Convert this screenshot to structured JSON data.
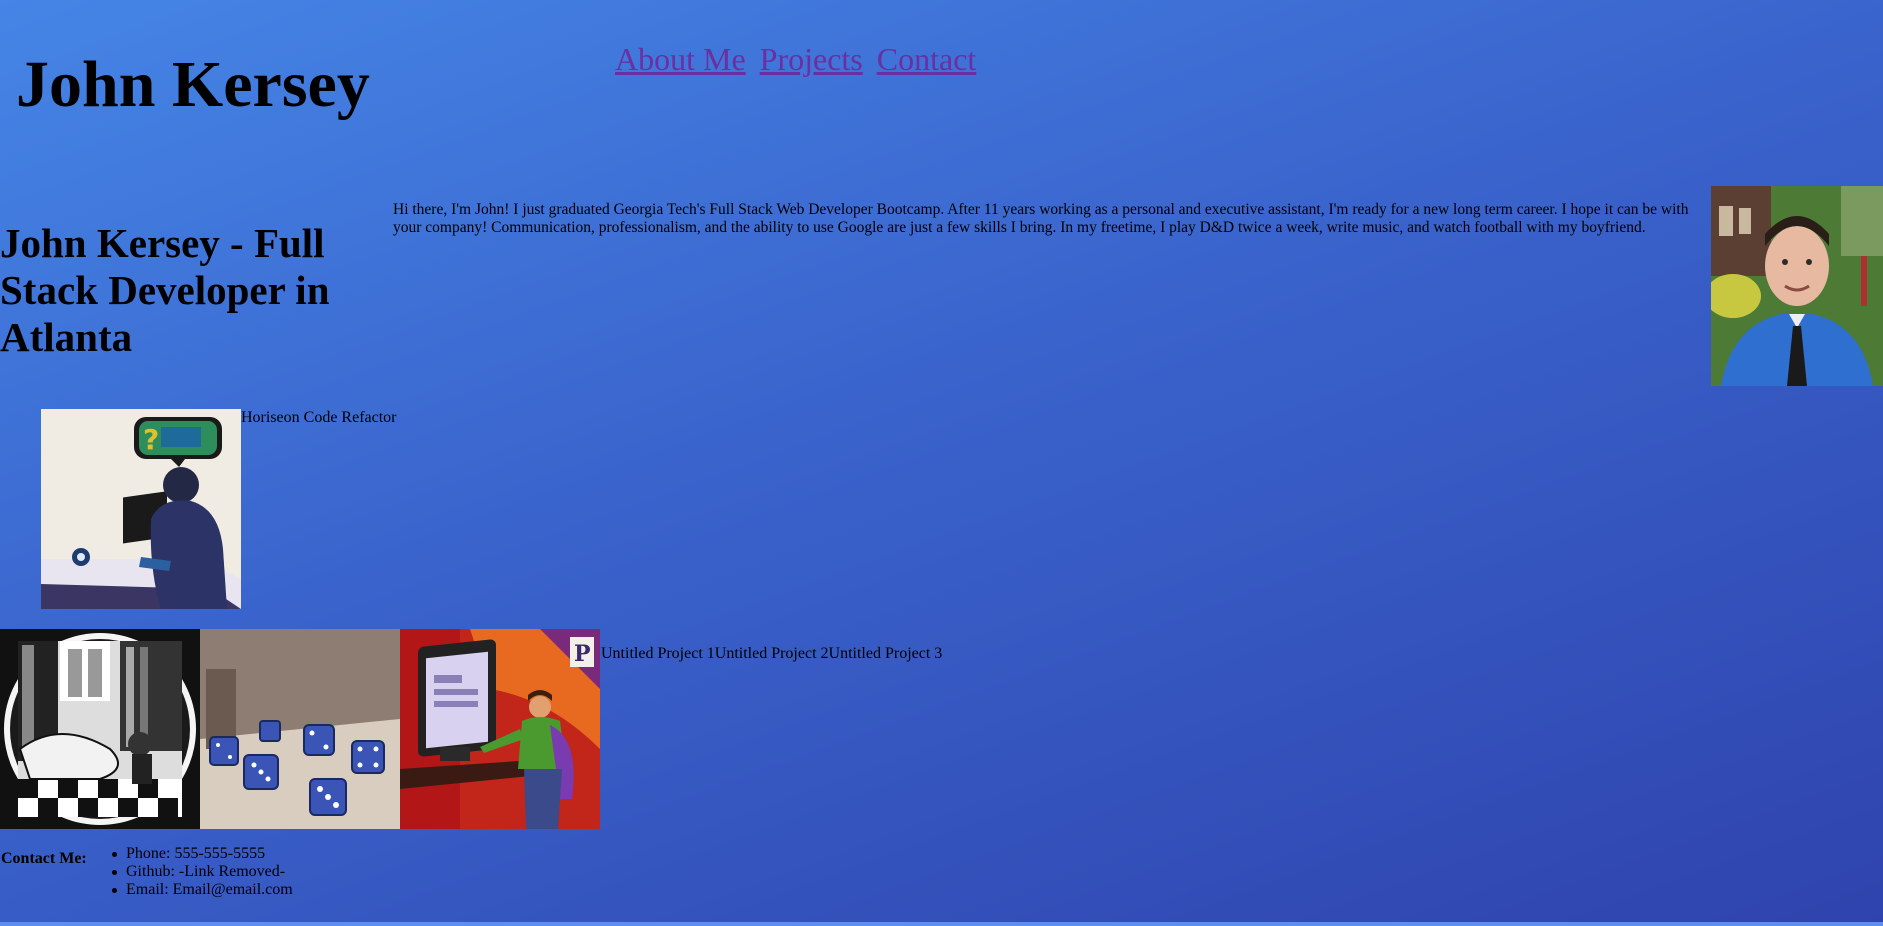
{
  "header": {
    "site_title": "John Kersey",
    "nav": [
      "About Me",
      "Projects",
      "Contact"
    ]
  },
  "about": {
    "headline": "John Kersey - Full Stack Developer in Atlanta",
    "bio": "Hi there, I'm John! I just graduated Georgia Tech's Full Stack Web Developer Bootcamp. After 11 years working as a personal and executive assistant, I'm ready for a new long term career. I hope it can be with your company! Communication, professionalism, and the ability to use Google are just a few skills I bring. In my freetime, I play D&D twice a week, write music, and watch football with my boyfriend."
  },
  "projects": {
    "featured_title": "Horiseon Code Refactor",
    "untitled": [
      "Untitled Project 1",
      "Untitled Project 2",
      "Untitled Project 3"
    ]
  },
  "contact": {
    "label": "Contact Me:",
    "items": [
      "Phone: 555-555-5555",
      "Github: -Link Removed-",
      "Email: Email@email.com"
    ]
  },
  "colors": {
    "background_top": "#4585e6",
    "background_bottom": "#2f43ad",
    "link_visited": "#6a2fa0"
  }
}
